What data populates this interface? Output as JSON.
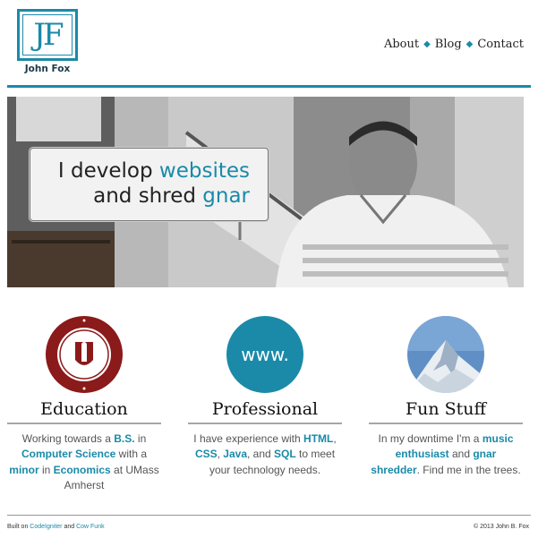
{
  "logo": {
    "mark": "JF",
    "name": "John Fox"
  },
  "nav": {
    "items": [
      "About",
      "Blog",
      "Contact"
    ],
    "separator": "◆"
  },
  "hero": {
    "line1_plain": "I develop ",
    "line1_highlight": "websites",
    "line2_plain": "and shred ",
    "line2_highlight": "gnar"
  },
  "columns": [
    {
      "title": "Education",
      "icon": "university-seal-icon",
      "text": [
        {
          "t": "Working towards a ",
          "hl": false
        },
        {
          "t": "B.S.",
          "hl": true
        },
        {
          "t": " in ",
          "hl": false
        },
        {
          "t": "Computer Science",
          "hl": true
        },
        {
          "t": " with a ",
          "hl": false
        },
        {
          "t": "minor",
          "hl": true
        },
        {
          "t": " in ",
          "hl": false
        },
        {
          "t": "Economics",
          "hl": true
        },
        {
          "t": " at UMass Amherst",
          "hl": false
        }
      ]
    },
    {
      "title": "Professional",
      "icon": "www-icon",
      "icon_text": "www.",
      "text": [
        {
          "t": "I have experience with ",
          "hl": false
        },
        {
          "t": "HTML",
          "hl": true
        },
        {
          "t": ", ",
          "hl": false
        },
        {
          "t": "CSS",
          "hl": true
        },
        {
          "t": ", ",
          "hl": false
        },
        {
          "t": "Java",
          "hl": true
        },
        {
          "t": ", and ",
          "hl": false
        },
        {
          "t": "SQL",
          "hl": true
        },
        {
          "t": " to meet your technology needs.",
          "hl": false
        }
      ]
    },
    {
      "title": "Fun Stuff",
      "icon": "mountain-icon",
      "text": [
        {
          "t": "In my downtime I'm a ",
          "hl": false
        },
        {
          "t": "music enthusiast",
          "hl": true
        },
        {
          "t": " and ",
          "hl": false
        },
        {
          "t": "gnar shredder",
          "hl": true
        },
        {
          "t": ". Find me in the trees.",
          "hl": false
        }
      ]
    }
  ],
  "footer": {
    "built_on": "Built on ",
    "link1": "CodeIgniter",
    "and": " and ",
    "link2": "Cow Funk",
    "copyright": "© 2013 John B. Fox"
  },
  "colors": {
    "accent": "#1a8aa8",
    "seal": "#8b1a1a"
  }
}
